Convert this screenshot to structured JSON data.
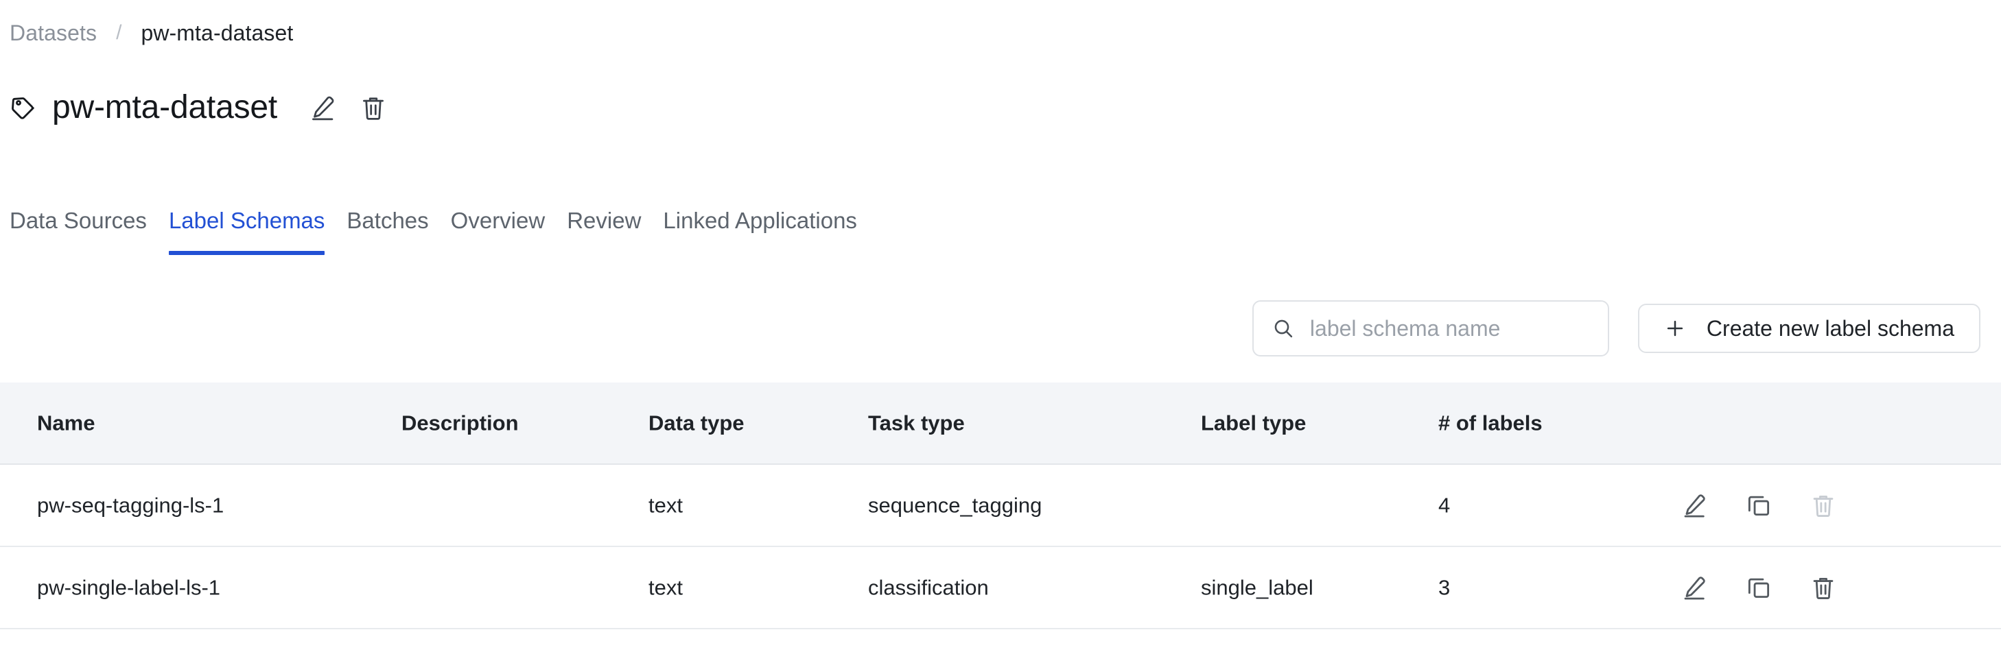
{
  "breadcrumb": {
    "parent": "Datasets",
    "separator": "/",
    "current": "pw-mta-dataset"
  },
  "header": {
    "tag_icon": "tag-icon",
    "title": "pw-mta-dataset",
    "edit_icon": "pencil-icon",
    "delete_icon": "trash-icon"
  },
  "tabs": [
    {
      "label": "Data Sources",
      "active": false
    },
    {
      "label": "Label Schemas",
      "active": true
    },
    {
      "label": "Batches",
      "active": false
    },
    {
      "label": "Overview",
      "active": false
    },
    {
      "label": "Review",
      "active": false
    },
    {
      "label": "Linked Applications",
      "active": false
    }
  ],
  "toolbar": {
    "search_icon": "search-icon",
    "search_placeholder": "label schema name",
    "search_value": "",
    "create_icon": "plus-icon",
    "create_label": "Create new label schema"
  },
  "table": {
    "columns": [
      "Name",
      "Description",
      "Data type",
      "Task type",
      "Label type",
      "# of labels"
    ],
    "rows": [
      {
        "name": "pw-seq-tagging-ls-1",
        "description": "",
        "data_type": "text",
        "task_type": "sequence_tagging",
        "label_type": "",
        "num_labels": "4",
        "actions": {
          "edit": "pencil-icon",
          "duplicate": "copy-icon",
          "delete": "trash-icon",
          "delete_disabled": true
        }
      },
      {
        "name": "pw-single-label-ls-1",
        "description": "",
        "data_type": "text",
        "task_type": "classification",
        "label_type": "single_label",
        "num_labels": "3",
        "actions": {
          "edit": "pencil-icon",
          "duplicate": "copy-icon",
          "delete": "trash-icon",
          "delete_disabled": false
        }
      }
    ]
  },
  "colors": {
    "accent": "#2250d4",
    "muted_text": "#5d646d",
    "header_bg": "#f3f5f8",
    "border": "#e3e6ea",
    "disabled_icon": "#c7ccd2"
  }
}
